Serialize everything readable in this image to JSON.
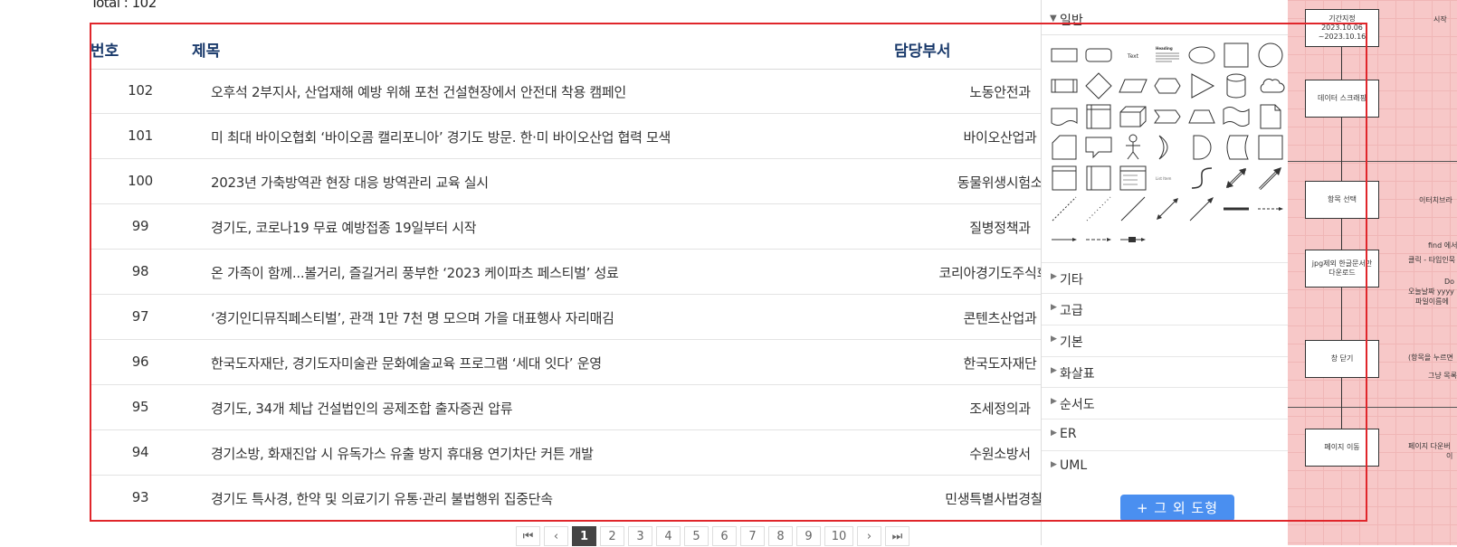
{
  "board": {
    "total": "Total : 102",
    "headers": {
      "no": "번호",
      "title": "제목",
      "dept": "담당부서"
    },
    "rows": [
      {
        "no": "102",
        "title": "오후석 2부지사, 산업재해 예방 위해 포천 건설현장에서 안전대 착용 캠페인",
        "dept": "노동안전과"
      },
      {
        "no": "101",
        "title": "미 최대 바이오협회 ‘바이오콤 캘리포니아’ 경기도 방문. 한·미 바이오산업 협력 모색",
        "dept": "바이오산업과"
      },
      {
        "no": "100",
        "title": "2023년 가축방역관 현장 대응 방역관리 교육 실시",
        "dept": "동물위생시험소"
      },
      {
        "no": "99",
        "title": "경기도, 코로나19 무료 예방접종 19일부터 시작",
        "dept": "질병정책과"
      },
      {
        "no": "98",
        "title": "온 가족이 함께...볼거리, 즐길거리 풍부한 ‘2023 케이파츠 페스티벌’ 성료",
        "dept": "코리아경기도주식회사"
      },
      {
        "no": "97",
        "title": "‘경기인디뮤직페스티벌’, 관객 1만 7천 명 모으며 가을 대표행사 자리매김",
        "dept": "콘텐츠산업과"
      },
      {
        "no": "96",
        "title": "한국도자재단, 경기도자미술관 문화예술교육 프로그램 ‘세대 잇다’ 운영",
        "dept": "한국도자재단"
      },
      {
        "no": "95",
        "title": "경기도, 34개 체납 건설법인의 공제조합 출자증권 압류",
        "dept": "조세정의과"
      },
      {
        "no": "94",
        "title": "경기소방, 화재진압 시 유독가스 유출 방지 휴대용 연기차단 커튼 개발",
        "dept": "수원소방서"
      },
      {
        "no": "93",
        "title": "경기도 특사경, 한약 및 의료기기 유통·관리 불법행위 집중단속",
        "dept": "민생특별사법경찰단"
      }
    ]
  },
  "pagination": {
    "first": "⏮",
    "prev": "‹",
    "pages": [
      "1",
      "2",
      "3",
      "4",
      "5",
      "6",
      "7",
      "8",
      "9",
      "10"
    ],
    "current": "1",
    "next": "›",
    "last": "⏭"
  },
  "shapes_panel": {
    "open_section": "일반",
    "sections": [
      "기타",
      "고급",
      "기본",
      "화살표",
      "순서도",
      "ER",
      "UML"
    ],
    "more_button": "+ 그 외 도형",
    "text_shape_label": "Text",
    "heading_shape_label": "Heading",
    "list_shape_label": "List Item"
  },
  "diagram": {
    "boxes": [
      {
        "lines": [
          "기간지정",
          "2023.10.06",
          "~2023.10.16"
        ]
      },
      {
        "lines": [
          "데이터 스크래핑"
        ]
      },
      {
        "lines": [
          "항목 선택"
        ]
      },
      {
        "lines": [
          "jpg제외 한글문서만",
          "다운로드"
        ]
      },
      {
        "lines": [
          "창 닫기"
        ]
      },
      {
        "lines": [
          "페이지 이동"
        ]
      }
    ],
    "notes": [
      "시작",
      "이터치브라",
      "find 에서 t",
      "클릭 - 타입인묵",
      "Do",
      "오늘날짜 yyyy",
      "파일이름에",
      "(항목을 누르면",
      "그냥 목록",
      "페이지 다운버",
      "이"
    ]
  },
  "colors": {
    "frame": "#e0262b",
    "header_text": "#1a3a6b",
    "button": "#4a8ff0",
    "diagram_bg": "#f7c8c8"
  }
}
